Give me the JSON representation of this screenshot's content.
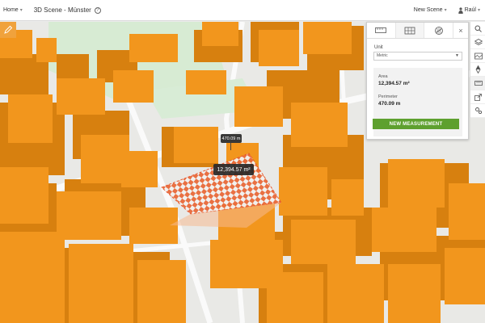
{
  "header": {
    "home_label": "Home",
    "title": "3D Scene - Münster",
    "new_scene_label": "New Scene",
    "user_name": "Raúl"
  },
  "panel": {
    "unit_label": "Unit",
    "unit_value": "Metric",
    "area_label": "Area",
    "area_value": "12,394.57 m²",
    "perimeter_label": "Perimeter",
    "perimeter_value": "470.09 m",
    "new_measurement_label": "NEW MEASUREMENT",
    "close_glyph": "×"
  },
  "scene_labels": {
    "perimeter": "470.09 m",
    "area": "12,394.57 m²"
  },
  "colors": {
    "building": "#f2961d",
    "building_dark": "#c9720e",
    "accent_green": "#5ea02f",
    "measure_red": "#e8552a"
  },
  "icons": {
    "left_tool": "pencil-icon",
    "toolbar": [
      "search-icon",
      "layers-icon",
      "basemap-icon",
      "compass-icon",
      "measure-icon",
      "share-icon",
      "settings-icon"
    ],
    "tabs": [
      "distance-icon",
      "area-icon",
      "slice-icon"
    ]
  }
}
